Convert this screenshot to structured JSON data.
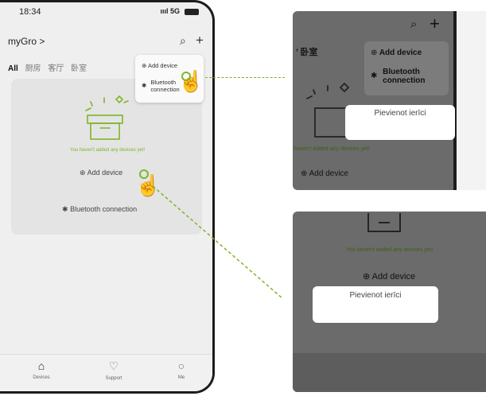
{
  "phone": {
    "status": {
      "time": "18:34",
      "network": "5G"
    },
    "brand": "myGro >",
    "tabs": [
      "All",
      "厨房",
      "客厅",
      "卧室"
    ],
    "popup_menu": {
      "add": "Add device",
      "bluetooth_line1": "Bluetooth",
      "bluetooth_line2": "connection"
    },
    "empty_text": "You haven't added any devices yet!",
    "add_device": "Add device",
    "bluetooth_connection": "Bluetooth connection",
    "nav": [
      {
        "label": "Devices"
      },
      {
        "label": "Support"
      },
      {
        "label": "Me"
      }
    ]
  },
  "zoom_top": {
    "room_label": "卧室",
    "menu": {
      "add": "Add device",
      "bluetooth_line1": "Bluetooth",
      "bluetooth_line2": "connection"
    },
    "tooltip": "Pievienot ierīci",
    "empty_text": "haven't added any devices yet!",
    "add_device": "Add device"
  },
  "zoom_bottom": {
    "empty_text": "You haven't added any devices yet!",
    "add_device": "Add device",
    "tooltip": "Pievienot ierīci"
  },
  "colors": {
    "accent_green": "#7fb52a",
    "dark_overlay": "#6b6b6b"
  },
  "icons": [
    "plus-circle-icon",
    "bluetooth-icon",
    "bell-icon",
    "plus-icon",
    "box-icon",
    "hand-pointer-icon",
    "home-icon",
    "support-icon",
    "profile-icon"
  ]
}
